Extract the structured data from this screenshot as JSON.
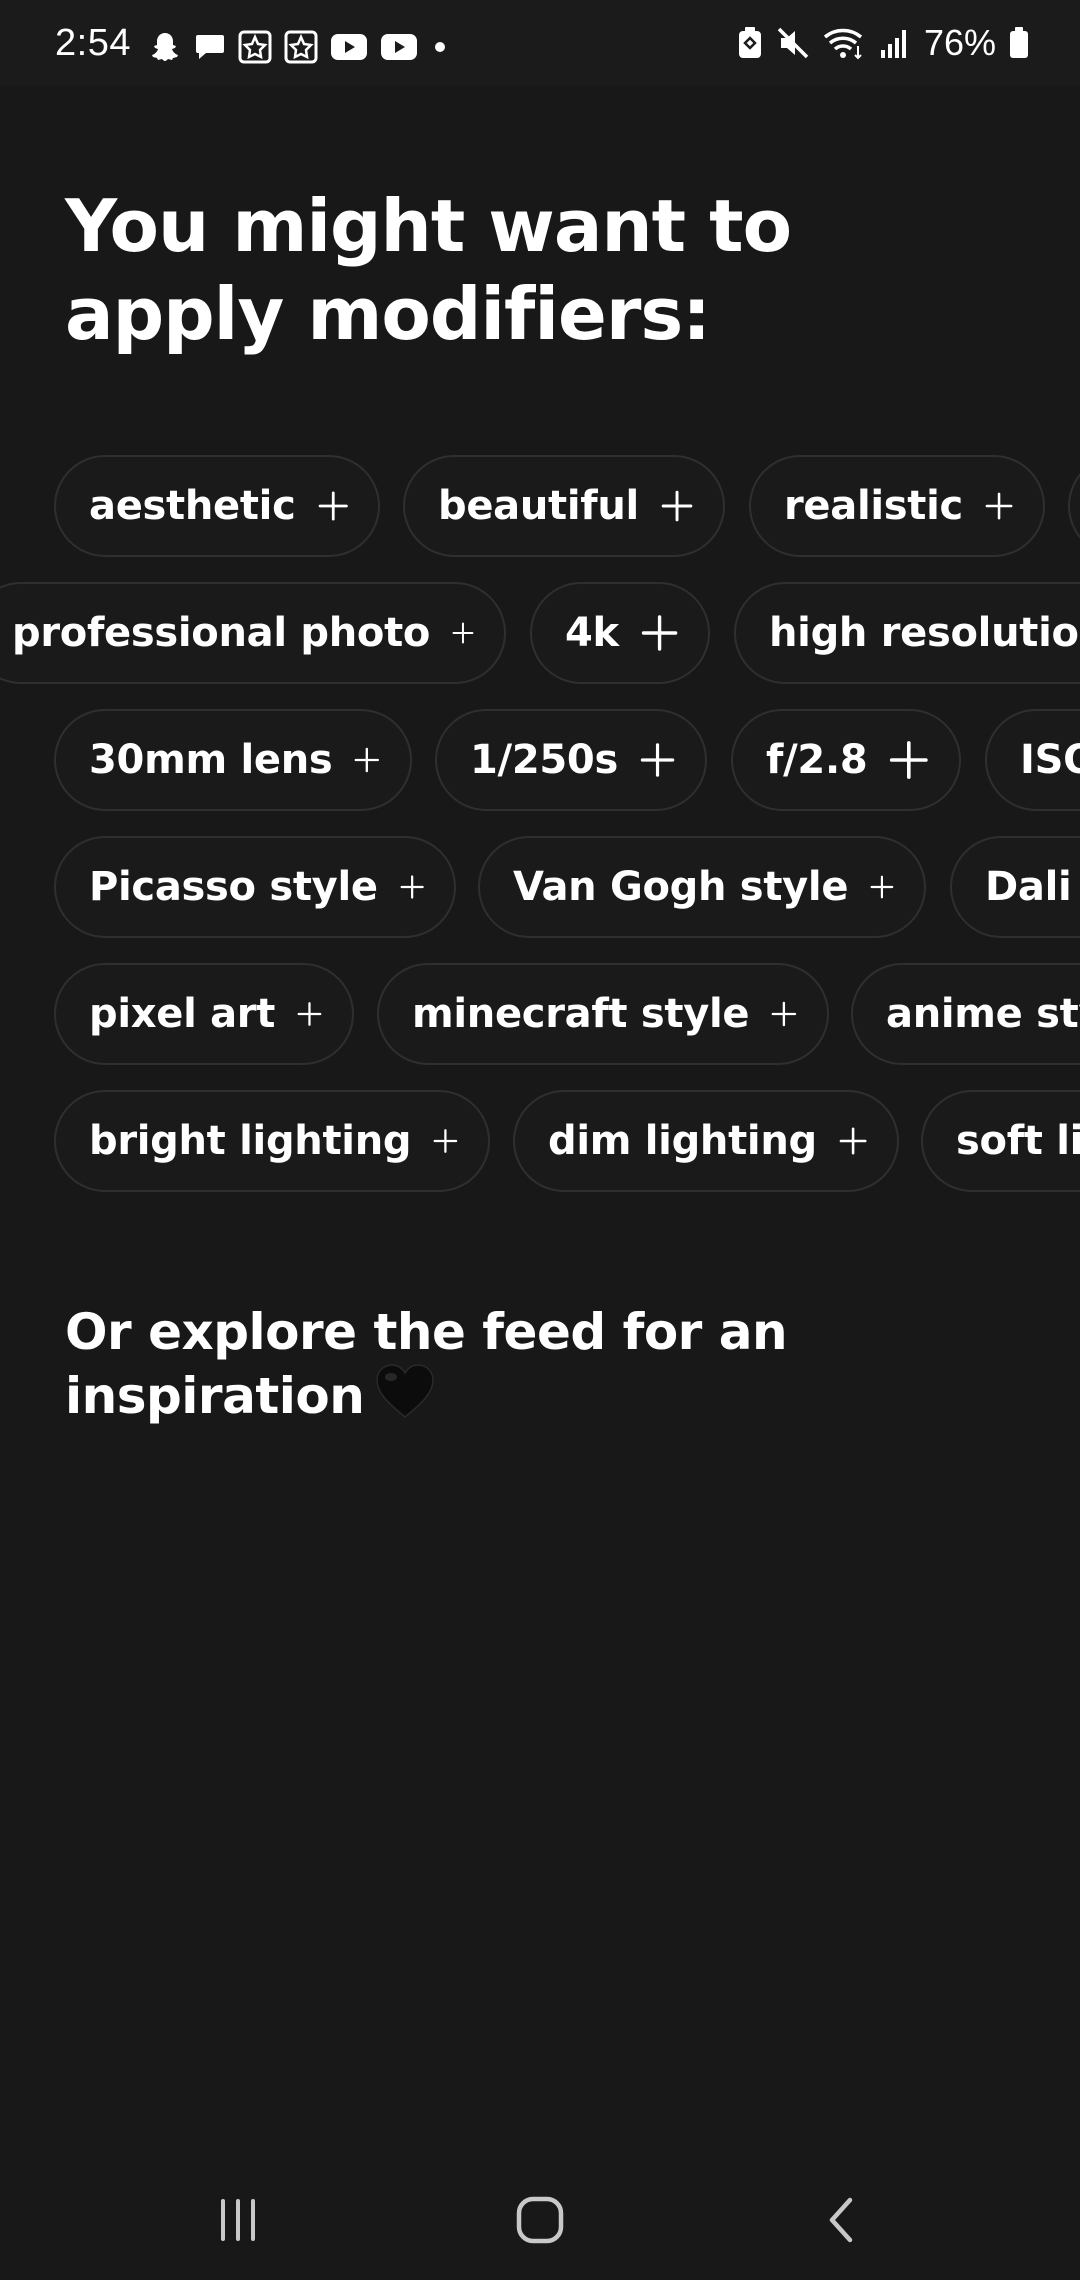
{
  "status_bar": {
    "time": "2:54",
    "battery_percent": "76%",
    "notification_icons": [
      "snapchat-icon",
      "message-icon",
      "star-app-icon",
      "star-app-icon",
      "youtube-icon",
      "youtube-icon",
      "more-dot-icon"
    ],
    "system_icons": [
      "battery-saver-icon",
      "mute-icon",
      "wifi-icon",
      "signal-icon",
      "battery-icon"
    ]
  },
  "main": {
    "headline": "You might want to apply modifiers:",
    "chip_rows": [
      [
        "aesthetic",
        "beautiful",
        "realistic",
        ""
      ],
      [
        "professional photo",
        "4k",
        "high resolution"
      ],
      [
        "30mm lens",
        "1/250s",
        "f/2.8",
        "ISO"
      ],
      [
        "Picasso style",
        "Van Gogh style",
        "Dali style"
      ],
      [
        "pixel art",
        "minecraft style",
        "anime style"
      ],
      [
        "bright lighting",
        "dim lighting",
        "soft lighting"
      ]
    ],
    "subheadline": "Or explore the feed for an inspiration",
    "subheadline_emoji": "black-heart-icon"
  },
  "nav_bar": {
    "buttons": [
      "recent-apps-icon",
      "home-icon",
      "back-icon"
    ]
  },
  "colors": {
    "background": "#181819",
    "chip_border": "#2f2f31",
    "text": "#ffffff"
  }
}
